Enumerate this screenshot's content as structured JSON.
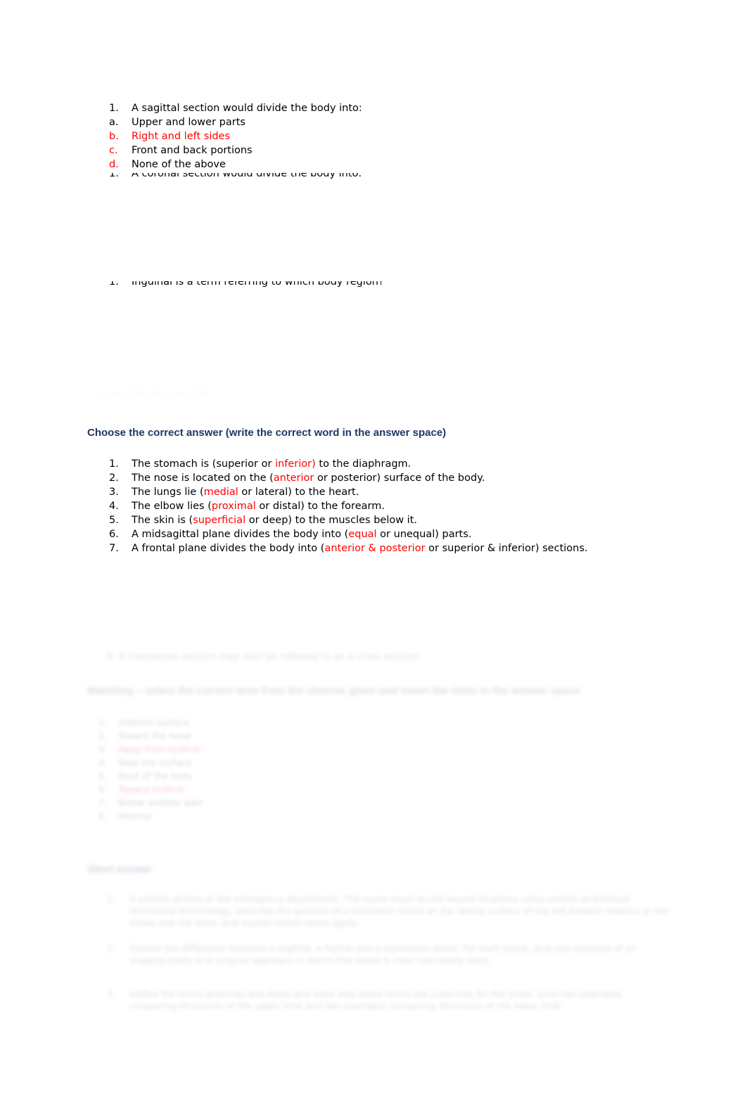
{
  "document": {
    "page_background": "#ffffff",
    "answer_color": "#FF0000",
    "heading_color": "#1F3864"
  },
  "question_1": {
    "stem": {
      "marker": "1.",
      "text": "A sagittal section would divide the body into:"
    },
    "options": [
      {
        "marker": "a.",
        "text": "Upper and lower parts",
        "marker_color": "#000000",
        "text_color": "#000000"
      },
      {
        "marker": "b.",
        "text": "Right and left sides",
        "marker_color": "#FF0000",
        "text_color": "#FF0000"
      },
      {
        "marker": "c.",
        "text": "Front and back portions",
        "marker_color": "#FF0000",
        "text_color": "#000000"
      },
      {
        "marker": "d.",
        "text": "None of the above",
        "marker_color": "#FF0000",
        "text_color": "#000000"
      }
    ]
  },
  "question_2": {
    "marker": "1.",
    "text": "A coronal section would divide the body into:"
  },
  "question_3": {
    "marker": "1.",
    "text": "Inguinal is a term referring to which body region?"
  },
  "faded_line_before_heading": "e. sagittal plane ventral",
  "choose_section": {
    "heading": "Choose the correct answer (write the correct word in the answer space)",
    "items": [
      {
        "marker": "1.",
        "parts": [
          {
            "text": "The stomach is (superior or ",
            "color": "#000000"
          },
          {
            "text": "inferior)",
            "color": "#FF0000"
          },
          {
            "text": " to the diaphragm.",
            "color": "#000000"
          }
        ]
      },
      {
        "marker": "2.",
        "parts": [
          {
            "text": "The nose is located on the (",
            "color": "#000000"
          },
          {
            "text": "anterior",
            "color": "#FF0000"
          },
          {
            "text": " or posterior) surface of the body.",
            "color": "#000000"
          }
        ]
      },
      {
        "marker": "3.",
        "parts": [
          {
            "text": "The lungs lie (",
            "color": "#000000"
          },
          {
            "text": "medial",
            "color": "#FF0000"
          },
          {
            "text": " or lateral) to the heart.",
            "color": "#000000"
          }
        ]
      },
      {
        "marker": "4.",
        "parts": [
          {
            "text": "The elbow lies (",
            "color": "#000000"
          },
          {
            "text": "proximal",
            "color": "#FF0000"
          },
          {
            "text": " or distal) to the forearm.",
            "color": "#000000"
          }
        ]
      },
      {
        "marker": "5.",
        "parts": [
          {
            "text": "The skin is (",
            "color": "#000000"
          },
          {
            "text": "superficial",
            "color": "#FF0000"
          },
          {
            "text": " or deep) to the muscles below it.",
            "color": "#000000"
          }
        ]
      },
      {
        "marker": "6.",
        "parts": [
          {
            "text": "A midsagittal plane divides the body into (",
            "color": "#000000"
          },
          {
            "text": "equal",
            "color": "#FF0000"
          },
          {
            "text": " or unequal) parts.",
            "color": "#000000"
          }
        ]
      },
      {
        "marker": "7.",
        "parts": [
          {
            "text": "A frontal plane divides the body into (",
            "color": "#000000"
          },
          {
            "text": "anterior & posterior",
            "color": "#FF0000"
          },
          {
            "text": " or superior & inferior) sections.",
            "color": "#000000"
          }
        ]
      }
    ]
  },
  "faded_item_8": "8.  A transverse section may also be referred to as a    cross section.",
  "matching_section": {
    "heading": "Matching – select the correct term from the choices given and insert the letter in the answer space",
    "rows": [
      {
        "marker": "1.",
        "label": "Anterior surface",
        "answer": ""
      },
      {
        "marker": "2.",
        "label": "Toward the head",
        "answer": ""
      },
      {
        "marker": "3.",
        "label": "Away from midline",
        "answer": ""
      },
      {
        "marker": "4.",
        "label": "Near the surface",
        "answer": ""
      },
      {
        "marker": "5.",
        "label": "Back of the body",
        "answer": ""
      },
      {
        "marker": "6.",
        "label": "Toward midline",
        "answer": ""
      },
      {
        "marker": "7.",
        "label": "Below another part",
        "answer": ""
      },
      {
        "marker": "8.",
        "label": "Internal",
        "answer": ""
      }
    ]
  },
  "short_answer_section": {
    "heading": "Short answer",
    "items": [
      {
        "marker": "1.",
        "text": "A patient arrives at the emergency department. The nurse must record wound locations using correct anatomical directional terminology. Describe the position of a laceration found on the lateral surface of the left forearm relative to the elbow and the wrist, and explain which terms apply."
      },
      {
        "marker": "2.",
        "text": "Explain the difference between a sagittal, a frontal and a transverse plane. For each plane, give one example of an imaging study or a surgical approach in which that plane is most commonly used."
      },
      {
        "marker": "3.",
        "text": "Define the terms proximal and distal and state why these terms are used only for the limbs. Give two examples comparing structures of the upper limb and two examples comparing structures of the lower limb."
      }
    ]
  }
}
